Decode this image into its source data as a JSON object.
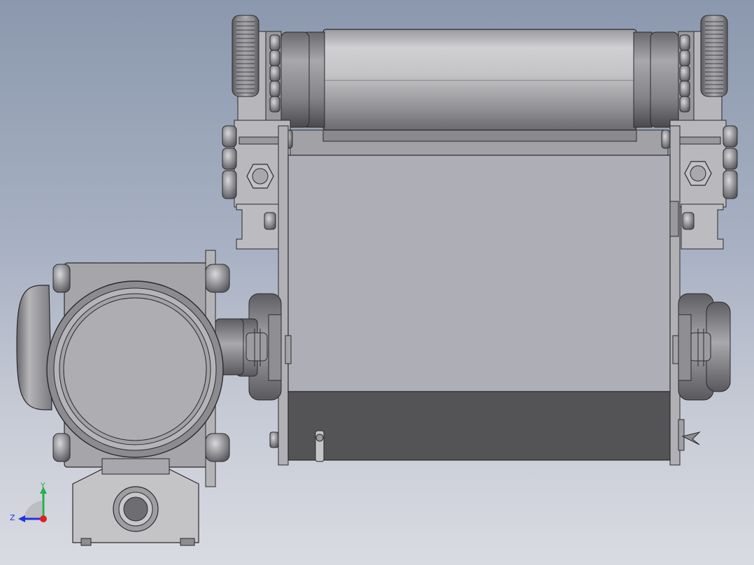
{
  "viewport": {
    "background_top": "#8b98ad",
    "background_bottom": "#d9dbe2"
  },
  "model": {
    "parts": [
      "drum-roller",
      "roller-frame-left",
      "roller-frame-right",
      "gear-left",
      "gear-right",
      "conveyor-body",
      "junction-box",
      "cable-gland-left",
      "cable-gland-right",
      "terminal-bracket"
    ],
    "colors": {
      "steel_light": "#c9c9cc",
      "steel_mid": "#a4a4a8",
      "steel_dark": "#5a5a5e",
      "panel": "#aeaeb7",
      "panel_dark": "#545457",
      "outline": "#2a2a2c"
    }
  },
  "triad": {
    "y_label": "Y",
    "z_label": "Z",
    "y_color": "#22b14c",
    "z_color": "#2233dd",
    "x_color": "#dd2222"
  }
}
